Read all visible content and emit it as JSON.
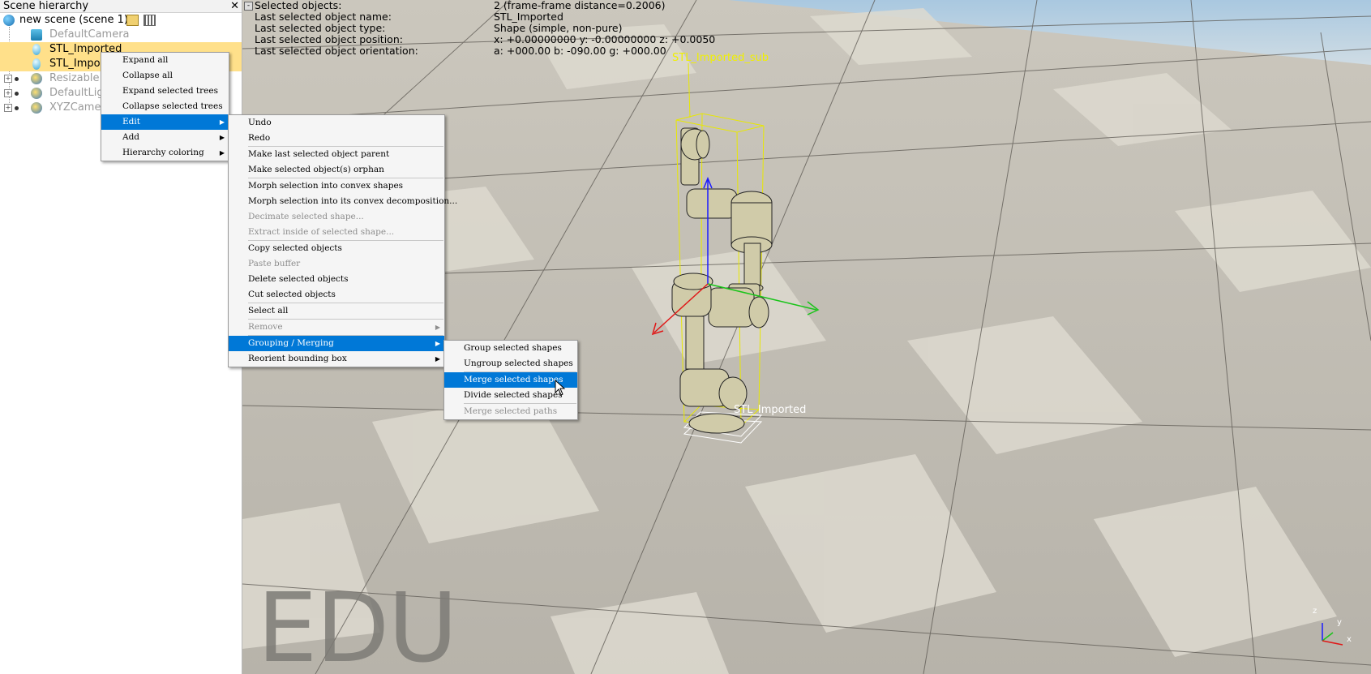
{
  "hierarchy": {
    "title": "Scene hierarchy",
    "close": "✕",
    "scene_label": "new scene (scene 1)",
    "items": [
      {
        "label": "DefaultCamera",
        "dim": true
      },
      {
        "label": "STL_Imported",
        "selected": true
      },
      {
        "label": "STL_Impo",
        "selected": true
      },
      {
        "label": "Resizable",
        "dim": true
      },
      {
        "label": "DefaultLigl",
        "dim": true
      },
      {
        "label": "XYZCame",
        "dim": true
      }
    ]
  },
  "info": {
    "rows": [
      {
        "k": "Selected objects:",
        "v": "2 (frame-frame distance=0.2006)"
      },
      {
        "k": "Last selected object name:",
        "v": "STL_Imported"
      },
      {
        "k": "Last selected object type:",
        "v": "Shape (simple, non-pure)"
      },
      {
        "k": "Last selected object position:",
        "v": "x: +0.00000000    y: -0.00000000    z: +0.0050"
      },
      {
        "k": "Last selected object orientation:",
        "v": "a: +000.00    b: -090.00    g: +000.00"
      }
    ],
    "box": "-"
  },
  "viewport": {
    "watermark": "EDU",
    "label_sub": "STL_Imported_sub",
    "label_obj": "STL_Imported",
    "axes": {
      "z": "z",
      "y": "y",
      "x": "x"
    }
  },
  "menu1": {
    "items": [
      {
        "label": "Expand all"
      },
      {
        "label": "Collapse all"
      },
      {
        "label": "Expand selected trees"
      },
      {
        "label": "Collapse selected trees"
      },
      {
        "label": "Edit",
        "submenu": true,
        "highlighted": true
      },
      {
        "label": "Add",
        "submenu": true
      },
      {
        "label": "Hierarchy coloring",
        "submenu": true
      }
    ]
  },
  "menu2": {
    "items": [
      {
        "label": "Undo"
      },
      {
        "label": "Redo"
      },
      {
        "sep": true
      },
      {
        "label": "Make last selected object parent"
      },
      {
        "label": "Make selected object(s) orphan"
      },
      {
        "sep": true
      },
      {
        "label": "Morph selection into convex shapes"
      },
      {
        "label": "Morph selection into its convex decomposition..."
      },
      {
        "label": "Decimate selected shape...",
        "disabled": true
      },
      {
        "label": "Extract inside of selected shape...",
        "disabled": true
      },
      {
        "sep": true
      },
      {
        "label": "Copy selected objects"
      },
      {
        "label": "Paste buffer",
        "disabled": true
      },
      {
        "label": "Delete selected objects"
      },
      {
        "label": "Cut selected objects"
      },
      {
        "sep": true
      },
      {
        "label": "Select all"
      },
      {
        "sep": true
      },
      {
        "label": "Remove",
        "disabled": true,
        "submenu": true
      },
      {
        "sep": true
      },
      {
        "label": "Grouping / Merging",
        "submenu": true,
        "highlighted": true
      },
      {
        "label": "Reorient bounding box",
        "submenu": true
      }
    ]
  },
  "menu3": {
    "items": [
      {
        "label": "Group selected shapes"
      },
      {
        "label": "Ungroup selected shapes"
      },
      {
        "sep": true
      },
      {
        "label": "Merge selected shapes",
        "highlighted": true
      },
      {
        "label": "Divide selected shapes"
      },
      {
        "sep": true
      },
      {
        "label": "Merge selected paths",
        "disabled": true
      }
    ]
  },
  "colors": {
    "highlight": "#0078d7",
    "selected_row": "#ffe08a",
    "bbox": "#e8e800",
    "robot": "#cfc9a8"
  }
}
